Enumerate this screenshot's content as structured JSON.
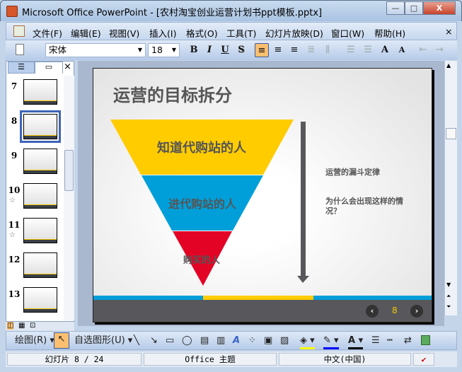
{
  "window": {
    "title": "Microsoft Office PowerPoint - [农村淘宝创业运营计划书ppt模板.pptx]",
    "minimize": "—",
    "restore": "□",
    "close": "X"
  },
  "menu": [
    "文件(F)",
    "编辑(E)",
    "视图(V)",
    "插入(I)",
    "格式(O)",
    "工具(T)",
    "幻灯片放映(D)",
    "窗口(W)",
    "帮助(H)"
  ],
  "menu_close": "×",
  "toolbar": {
    "font": "宋体",
    "size": "18",
    "bold": "B",
    "italic": "I",
    "underline": "U",
    "shadow": "S",
    "grow": "A",
    "shrink": "A"
  },
  "leftpane": {
    "close": "×",
    "slides": [
      {
        "num": "7"
      },
      {
        "num": "8",
        "selected": true
      },
      {
        "num": "9"
      },
      {
        "num": "10",
        "anim": "☆"
      },
      {
        "num": "11",
        "anim": "☆"
      },
      {
        "num": "12"
      },
      {
        "num": "13"
      }
    ]
  },
  "slide": {
    "title": "运营的目标拆分",
    "funnel": [
      "知道代购站的人",
      "进代购站的人",
      "购买的人"
    ],
    "note1": "运营的漏斗定律",
    "note2": "为什么会出现这样的情况？",
    "page": "8",
    "colors": {
      "yellow": "#ffcc00",
      "blue": "#009fd9",
      "red": "#e30425",
      "dark": "#58585c"
    }
  },
  "drawbar": {
    "draw": "绘图(R)",
    "autoshapes": "自选图形(U)"
  },
  "status": {
    "slide": "幻灯片 8 / 24",
    "theme": "Office 主题",
    "lang": "中文(中国)"
  }
}
